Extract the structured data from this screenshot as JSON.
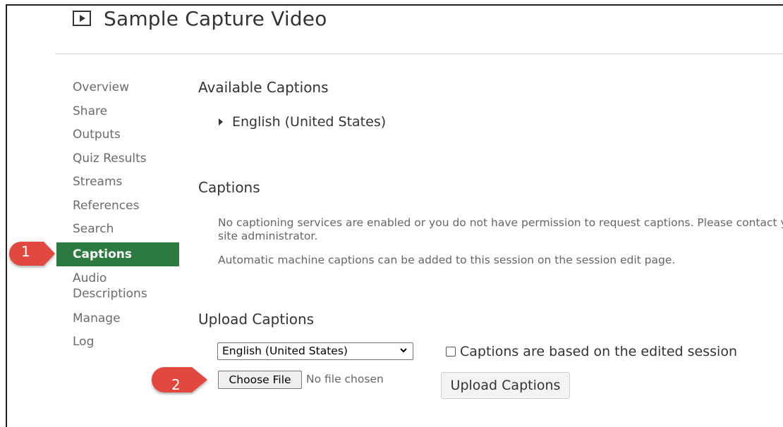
{
  "header": {
    "title": "Sample Capture Video",
    "icon": "video-play-icon"
  },
  "sidebar": {
    "items": [
      {
        "label": "Overview"
      },
      {
        "label": "Share"
      },
      {
        "label": "Outputs"
      },
      {
        "label": "Quiz Results"
      },
      {
        "label": "Streams"
      },
      {
        "label": "References"
      },
      {
        "label": "Search"
      },
      {
        "label": "Captions",
        "active": true
      },
      {
        "label": "Audio Descriptions"
      },
      {
        "label": "Manage"
      },
      {
        "label": "Log"
      }
    ],
    "active_color": "#2b7a3f"
  },
  "available_captions": {
    "heading": "Available Captions",
    "items": [
      {
        "label": "English (United States)"
      }
    ]
  },
  "captions_section": {
    "heading": "Captions",
    "notice_line1": "No captioning services are enabled or you do not have permission to request captions. Please contact y",
    "notice_line2": "site administrator.",
    "notice_line3": "Automatic machine captions can be added to this session on the session edit page."
  },
  "upload": {
    "heading": "Upload Captions",
    "language_selected": "English (United States)",
    "checkbox_label": "Captions are based on the edited session",
    "checkbox_checked": false,
    "choose_file_label": "Choose File",
    "file_status": "No file chosen",
    "upload_button_label": "Upload Captions"
  },
  "callouts": [
    {
      "number": "1",
      "target": "Captions"
    },
    {
      "number": "2",
      "target": "Choose File"
    }
  ],
  "colors": {
    "callout": "#e2473f",
    "active": "#2b7a3f"
  }
}
